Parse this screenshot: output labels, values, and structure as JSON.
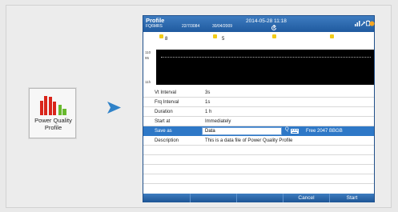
{
  "app_tile": {
    "label_line1": "Power Quality",
    "label_line2": "Profile",
    "icon": "bar-chart-icon",
    "bar_colors": [
      "#d9241a",
      "#d9241a",
      "#68b92e",
      "#68b92e"
    ]
  },
  "arrow_icon": "right-arrow-icon",
  "device": {
    "title": "Profile",
    "sub_info": "FQ6MRS",
    "sub_date1": "22/7/3084",
    "sub_date2": "30/04/2009",
    "datetime": "2014-05-28 11:18",
    "refresh_icon": "refresh-icon",
    "status_icons": [
      "signal-icon",
      "plug-icon",
      "battery-icon",
      "power-icon"
    ],
    "ruler_markers": [
      "8",
      "5"
    ],
    "chart": {
      "top_labels": [
        "110",
        "95"
      ],
      "bottom_label": "11h"
    },
    "fields": [
      {
        "key": "Vt Interval",
        "value": "3s"
      },
      {
        "key": "Frq Interval",
        "value": "1s"
      },
      {
        "key": "Duration",
        "value": "1 h"
      },
      {
        "key": "Start at",
        "value": "Immediately"
      }
    ],
    "save_as": {
      "key": "Save as",
      "input_value": "Data",
      "button_label": "Q",
      "button_icon": "keyboard-icon",
      "free_text": "Free 2047 BBGB"
    },
    "description": {
      "key": "Description",
      "value": "This is a data file of Power Quality Profile"
    },
    "buttons": [
      {
        "label": ""
      },
      {
        "label": ""
      },
      {
        "label": ""
      },
      {
        "label": "Cancel"
      },
      {
        "label": "Start"
      }
    ]
  },
  "colors": {
    "accent": "#2e78c7",
    "header_top": "#3e7cc0",
    "marker": "#f3cc17"
  }
}
